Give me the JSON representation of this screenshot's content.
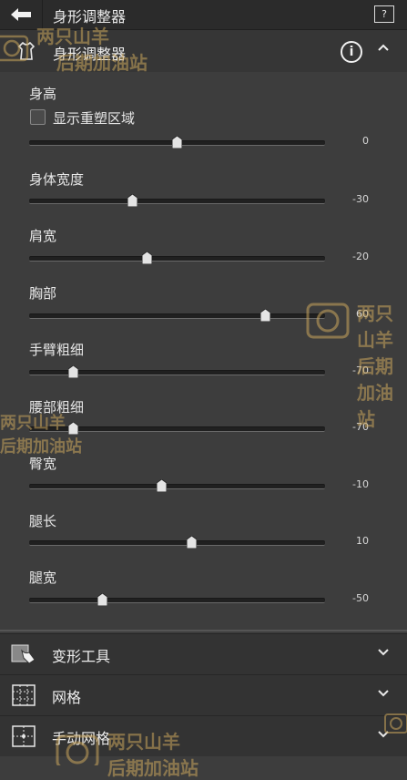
{
  "topbar": {
    "title": "身形调整器",
    "help_icon": "help-icon"
  },
  "section": {
    "title": "身形调整器",
    "icon": "body-shape-icon",
    "info_icon": "info-icon",
    "collapse_icon": "chevron-up-icon"
  },
  "checkbox": {
    "label": "显示重塑区域",
    "checked": false
  },
  "sliders": [
    {
      "label": "身高",
      "value": "0",
      "level": 0
    },
    {
      "label": "身体宽度",
      "value": "-30",
      "level": -30
    },
    {
      "label": "肩宽",
      "value": "-20",
      "level": -20
    },
    {
      "label": "胸部",
      "value": "60",
      "level": 60
    },
    {
      "label": "手臂粗细",
      "value": "-70",
      "level": -70
    },
    {
      "label": "腰部粗细",
      "value": "-70",
      "level": -70
    },
    {
      "label": "臀宽",
      "value": "-10",
      "level": -10
    },
    {
      "label": "腿长",
      "value": "10",
      "level": 10
    },
    {
      "label": "腿宽",
      "value": "-50",
      "level": -50
    }
  ],
  "panels": [
    {
      "label": "变形工具",
      "icon": "warp-tool-icon"
    },
    {
      "label": "网格",
      "icon": "grid-icon"
    },
    {
      "label": "手动网格",
      "icon": "manual-grid-icon"
    }
  ],
  "watermark": {
    "line1": "两只山羊",
    "line2": "后期加油站"
  },
  "colors": {
    "background": "#3d3d3d",
    "watermark": "#c9a55c"
  }
}
